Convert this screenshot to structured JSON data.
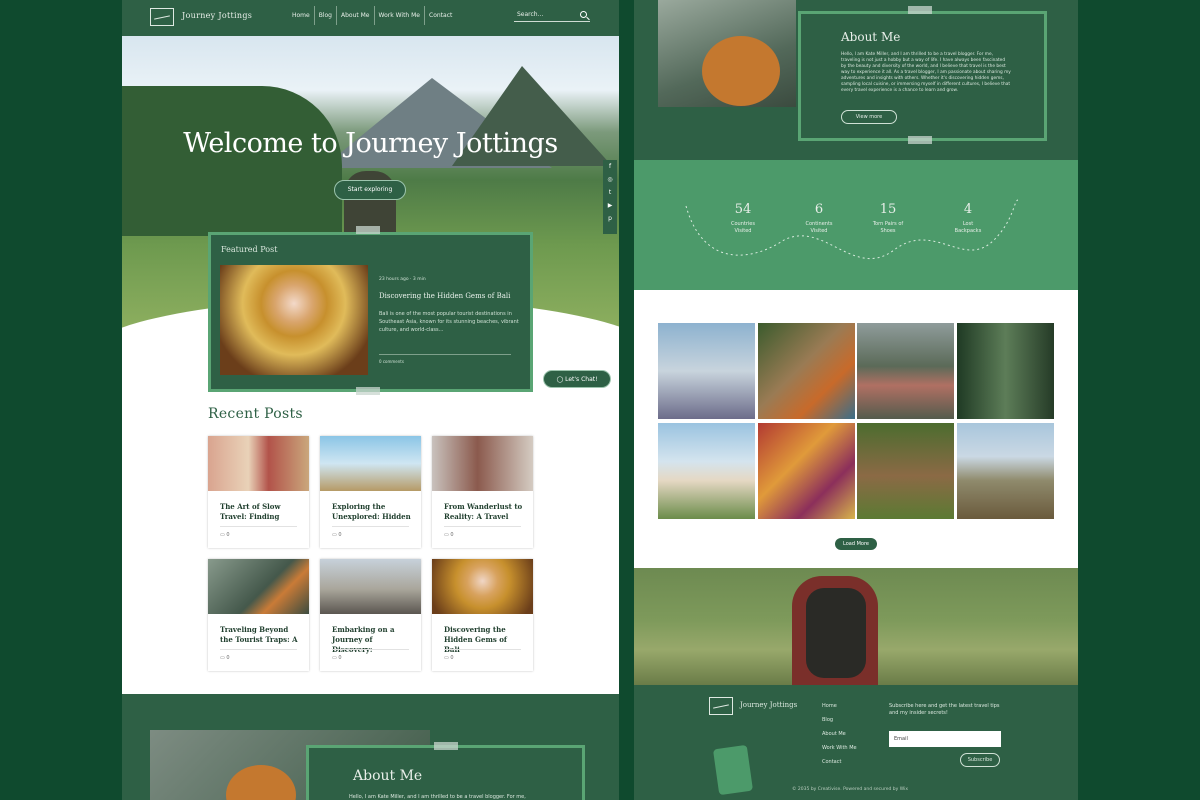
{
  "nav": {
    "brand": "Journey Jottings",
    "items": [
      "Home",
      "Blog",
      "About Me",
      "Work With Me",
      "Contact"
    ],
    "search_placeholder": "Search..."
  },
  "hero": {
    "title": "Welcome to Journey Jottings",
    "cta": "Start exploring"
  },
  "social": [
    "f",
    "◎",
    "t",
    "▶",
    "p"
  ],
  "featured": {
    "heading": "Featured Post",
    "meta": "23 hours ago · 3 min",
    "title": "Discovering the Hidden Gems of Bali",
    "excerpt": "Bali is one of the most popular tourist destinations in Southeast Asia, known for its stunning beaches, vibrant culture, and world-class...",
    "comments": "0 comments"
  },
  "chat": {
    "label": "Let's Chat!"
  },
  "recent": {
    "heading": "Recent Posts",
    "posts": [
      {
        "title": "The Art of Slow Travel: Finding",
        "comments": "0"
      },
      {
        "title": "Exploring the Unexplored: Hidden",
        "comments": "0"
      },
      {
        "title": "From Wanderlust to Reality: A Travel",
        "comments": "0"
      },
      {
        "title": "Traveling Beyond the Tourist Traps: A",
        "comments": "0"
      },
      {
        "title": "Embarking on a Journey of Discovery:",
        "comments": "0"
      },
      {
        "title": "Discovering the Hidden Gems of Bali",
        "comments": "0"
      }
    ]
  },
  "about": {
    "heading": "About Me",
    "text_short": "Hello, I am Kate Miller, and I am thrilled to be a travel blogger. For me,",
    "text": "Hello, I am Kate Miller, and I am thrilled to be a travel blogger. For me, traveling is not just a hobby but a way of life. I have always been fascinated by the beauty and diversity of the world, and I believe that travel is the best way to experience it all. As a travel blogger, I am passionate about sharing my adventures and insights with others. Whether it's discovering hidden gems, sampling local cuisine, or immersing myself in different cultures, I believe that every travel experience is a chance to learn and grow.",
    "button": "View more"
  },
  "stats": [
    {
      "value": "54",
      "label1": "Countries",
      "label2": "Visited"
    },
    {
      "value": "6",
      "label1": "Continents",
      "label2": "Visited"
    },
    {
      "value": "15",
      "label1": "Torn Pairs of",
      "label2": "Shoes"
    },
    {
      "value": "4",
      "label1": "Lost",
      "label2": "Backpacks"
    }
  ],
  "gallery": {
    "load_more": "Load More"
  },
  "footer": {
    "brand": "Journey Jottings",
    "links": [
      "Home",
      "Blog",
      "About Me",
      "Work With Me",
      "Contact"
    ],
    "subscribe_text": "Subscribe here and get the latest travel tips and my insider secrets!",
    "email_placeholder": "Email",
    "subscribe_button": "Subscribe",
    "copyright": "© 2035 by Creativise. Powered and secured by Wix"
  }
}
